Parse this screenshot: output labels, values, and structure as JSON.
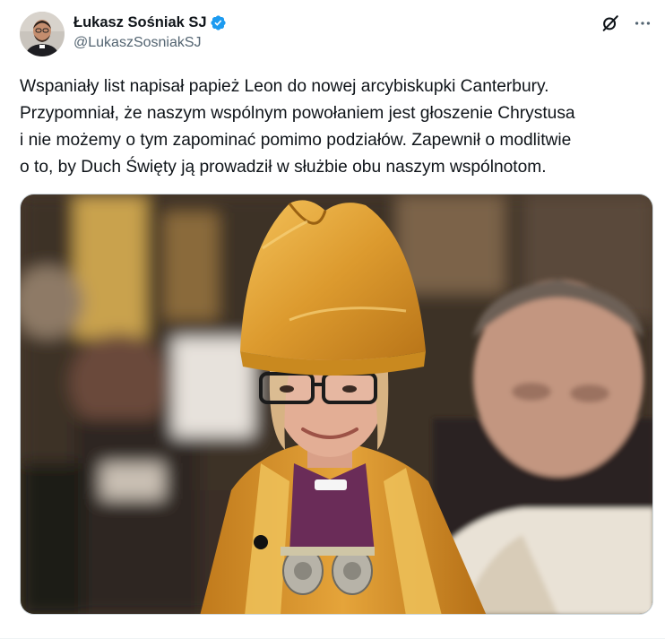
{
  "author": {
    "display_name": "Łukasz Sośniak SJ",
    "handle": "@LukaszSosniakSJ",
    "verified": true,
    "avatar_icon": "avatar-photo"
  },
  "header_actions": {
    "grok_icon": "grok-icon",
    "more_icon": "more-icon"
  },
  "tweet": {
    "text": "Wspaniały list napisał papież Leon do nowej arcybiskupki Canterbury.\nPrzypomniał, że naszym wspólnym powołaniem jest głoszenie Chrystusa\ni nie możemy o tym zapominać pomimo podziałów. Zapewnił o modlitwie\no to, by Duch Święty ją prowadził w służbie obu naszym wspólnotom."
  },
  "media": {
    "kind": "photo",
    "icon": "photo-image"
  },
  "colors": {
    "verified_blue": "#1d9bf0",
    "secondary_text": "#536471",
    "primary_text": "#0f1419"
  }
}
